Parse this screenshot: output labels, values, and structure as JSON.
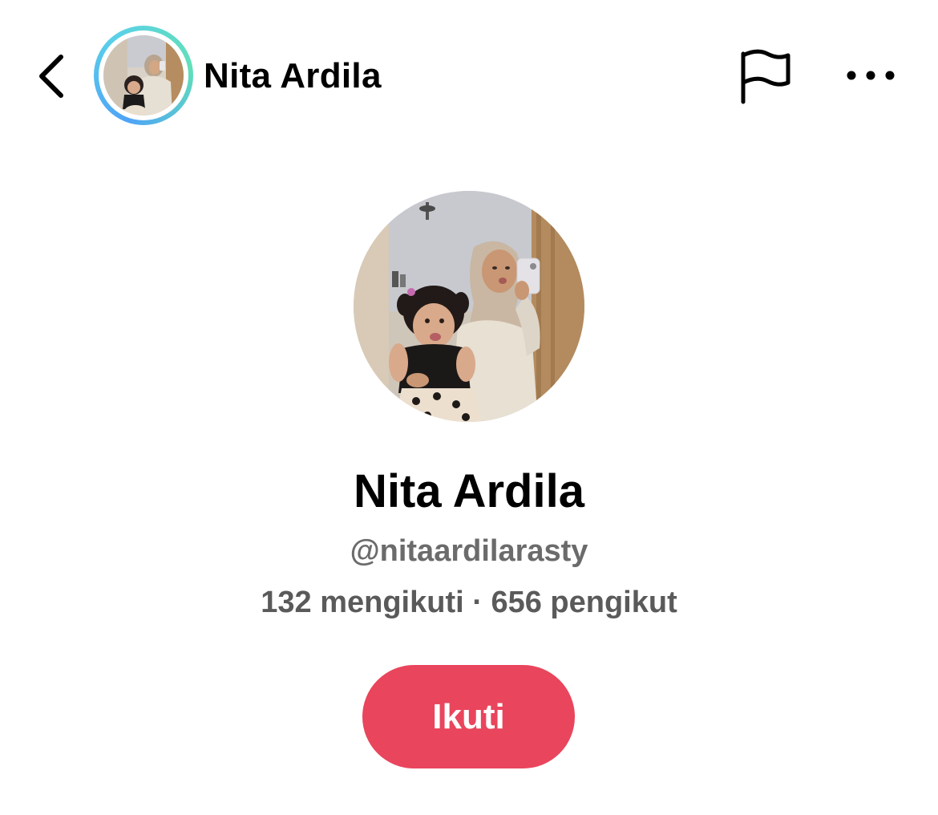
{
  "header": {
    "back_icon": "chevron-left-icon",
    "name": "Nita Ardila",
    "flag_icon": "flag-icon",
    "more_icon": "more-horizontal-icon",
    "story_ring_colors": [
      "#4fa3f7",
      "#5ad0e8",
      "#62e0b8"
    ]
  },
  "profile": {
    "name": "Nita Ardila",
    "handle": "@nitaardilarasty",
    "stats": "132 mengikuti · 656 pengikut",
    "follow_label": "Ikuti"
  },
  "colors": {
    "accent": "#e9455c",
    "secondary_text": "#6b6b6b"
  }
}
